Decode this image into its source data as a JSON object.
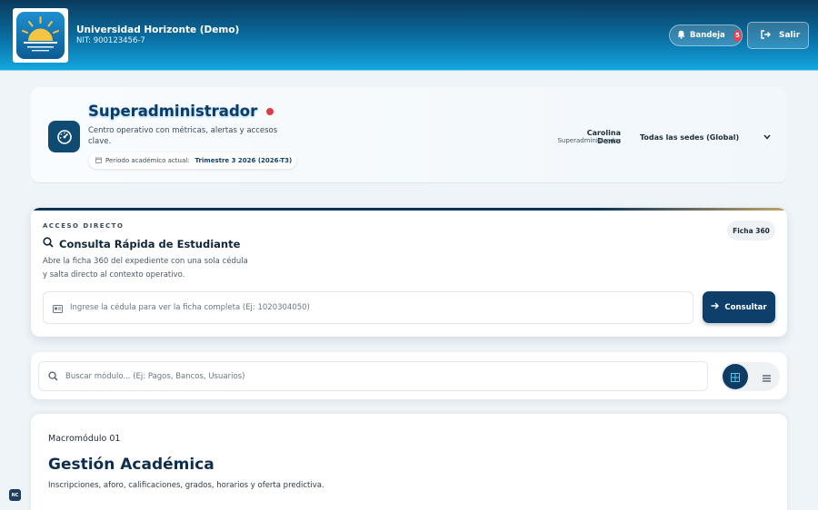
{
  "header": {
    "org_name": "Universidad Horizonte (Demo)",
    "nit": "NIT: 900123456-7",
    "inbox_label": "Bandeja",
    "inbox_count": "5",
    "exit_label": "Salir"
  },
  "profile": {
    "role_title": "Superadministrador",
    "description": "Centro operativo con métricas, alertas y accesos clave.",
    "period_label": "Periodo académico actual:",
    "period_value": "Trimestre 3 2026 (2026-T3)",
    "user_name": "Carolina Demo",
    "user_role": "Superadministrador",
    "sede_selected": "Todas las sedes (Global)"
  },
  "quick_consult": {
    "kicker": "ACCESO DIRECTO",
    "title": "Consulta Rápida de Estudiante",
    "description": "Abre la ficha 360 del expediente con una sola cédula y salta directo al contexto operativo.",
    "badge": "Ficha 360",
    "input_placeholder": "Ingrese la cédula para ver la ficha completa (Ej: 1020304050)",
    "button_label": "Consultar"
  },
  "module_search": {
    "placeholder": "Buscar módulo... (Ej: Pagos, Bancos, Usuarios)"
  },
  "module": {
    "number": "Macromódulo 01",
    "title": "Gestión Académica",
    "description": "Inscripciones, aforo, calificaciones, grados, horarios y oferta predictiva."
  },
  "corner_badge": "NC",
  "colors": {
    "brand_dark": "#0d3f6a",
    "header_light": "#12a6de",
    "alert_red": "#e03a45"
  }
}
